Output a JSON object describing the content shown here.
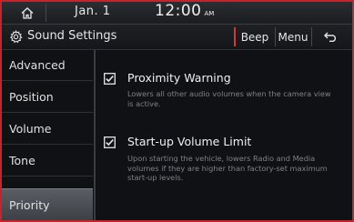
{
  "status_bar": {
    "date": "Jan. 1",
    "time": "12:00",
    "ampm": "AM",
    "home_icon": "home-icon"
  },
  "title_bar": {
    "title": "Sound Settings",
    "beep_label": "Beep",
    "menu_label": "Menu",
    "back_icon": "back-arrow-icon"
  },
  "sidebar": {
    "items": [
      {
        "label": "Advanced"
      },
      {
        "label": "Position"
      },
      {
        "label": "Volume"
      },
      {
        "label": "Tone"
      },
      {
        "label": "Priority",
        "selected": true
      }
    ]
  },
  "options": [
    {
      "label": "Proximity Warning",
      "checked": true,
      "description": "Lowers all other audio volumes when the camera view is active."
    },
    {
      "label": "Start-up Volume Limit",
      "checked": true,
      "description": "Upon starting the vehicle, lowers Radio and Media volumes if they are higher than factory-set maximum start-up levels."
    }
  ],
  "colors": {
    "accent": "#d33a2c",
    "frame_border": "#c4242b",
    "background": "#0f1114"
  }
}
